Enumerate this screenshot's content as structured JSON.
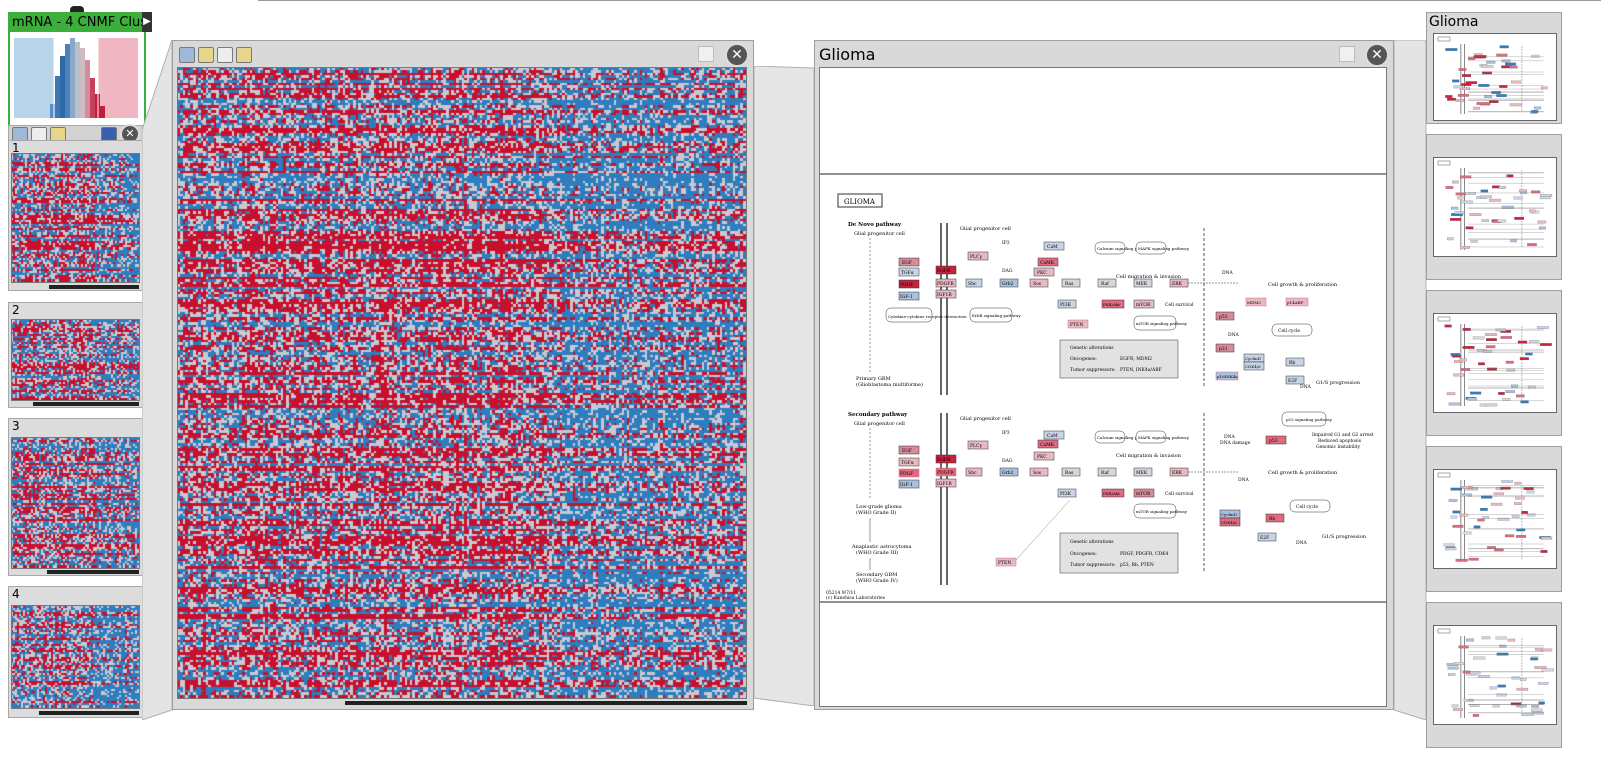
{
  "stratification": {
    "title": "mRNA - 4 CNMF Clus",
    "groups": [
      {
        "label": "1"
      },
      {
        "label": "2"
      },
      {
        "label": "3"
      },
      {
        "label": "4"
      }
    ]
  },
  "pathway": {
    "title": "Glioma",
    "kegg_label": "GLIOMA",
    "de_novo_title": "De Novo pathway",
    "secondary_title": "Secondary pathway",
    "glial_cell": "Glial progenitor cell",
    "primary_gbm": "Primary GBM",
    "primary_gbm_sub": "(Glioblastoma multiforme)",
    "low_grade": "Low-grade glioma",
    "low_grade_sub": "(WHO Grade II)",
    "anaplastic": "Anaplastic astrocytoma",
    "anaplastic_sub": "(WHO Grade III)",
    "secondary_gbm": "Secondary GBM",
    "secondary_gbm_sub": "(WHO Grade IV)",
    "cell_migration": "Cell migration & invasion",
    "cell_growth": "Cell growth & proliferation",
    "cell_survival": "Cell survival",
    "cell_cycle": "Cell cycle",
    "g1s": "G1/S progression",
    "calcium": "Calcium signaling pathway",
    "mapk": "MAPK signaling pathway",
    "erb": "ErbB signaling pathway",
    "mtor": "mTOR signaling pathway",
    "cytokine": "Cytokine-cytokine receptor interaction",
    "p53": "p53 signaling pathway",
    "dna": "DNA",
    "dna_damage": "DNA damage",
    "p53_outcomes": [
      "Impaired G1 and G2 arrest",
      "Reduced apoptosis",
      "Genomic instability"
    ],
    "genetic_1": {
      "title": "Genetic alterations",
      "oncogenes_label": "Oncogenes:",
      "oncogenes": "EGFR, MDM2",
      "tumor_label": "Tumor suppressors:",
      "tumor": "PTEN, INK4a/ARF"
    },
    "genetic_2": {
      "title": "Genetic alterations",
      "oncogenes_label": "Oncogenes:",
      "oncogenes": "PDGF, PDGFR, CDK4",
      "tumor_label": "Tumor suppressors:",
      "tumor": "p53, Rb, PTEN"
    },
    "footer_1": "05214 9/7/11",
    "footer_2": "(c) Kanehisa Laboratories",
    "genes": {
      "egf": "EGF",
      "tgfa": "TGFα",
      "pdgf": "PDGF",
      "igf1": "IGF-1",
      "egfr": "EGFR",
      "pdgfr": "PDGFR",
      "igf1r": "IGF1R",
      "plcg": "PLCγ",
      "ip3": "IP3",
      "dag": "DAG",
      "cam": "CaM",
      "camk": "CaMK",
      "pkc": "PKC",
      "shc": "Shc",
      "grb2": "Grb2",
      "sos": "Sos",
      "ras": "Ras",
      "raf": "Raf",
      "mek": "MEK",
      "erk": "ERK",
      "pi3k": "PI3K",
      "pip3": "PIP3",
      "pten": "PTEN",
      "akt": "PKB/Akt",
      "mtor": "mTOR",
      "mdm2": "MDM2",
      "p14arf": "p14ARF",
      "p53": "p53",
      "p21": "p21",
      "cdk4": "CDK4/6",
      "cyclind": "CyclinD",
      "p16": "p16INK4a",
      "rb": "Rb",
      "e2f": "E2F",
      "ca": "Ca2+",
      "pp": "+p"
    }
  },
  "side": {
    "title": "Glioma"
  },
  "colors": {
    "red": "#c8102e",
    "blue": "#2e7dbf",
    "neutral": "#c9c9cf",
    "green": "#3cae3c"
  }
}
